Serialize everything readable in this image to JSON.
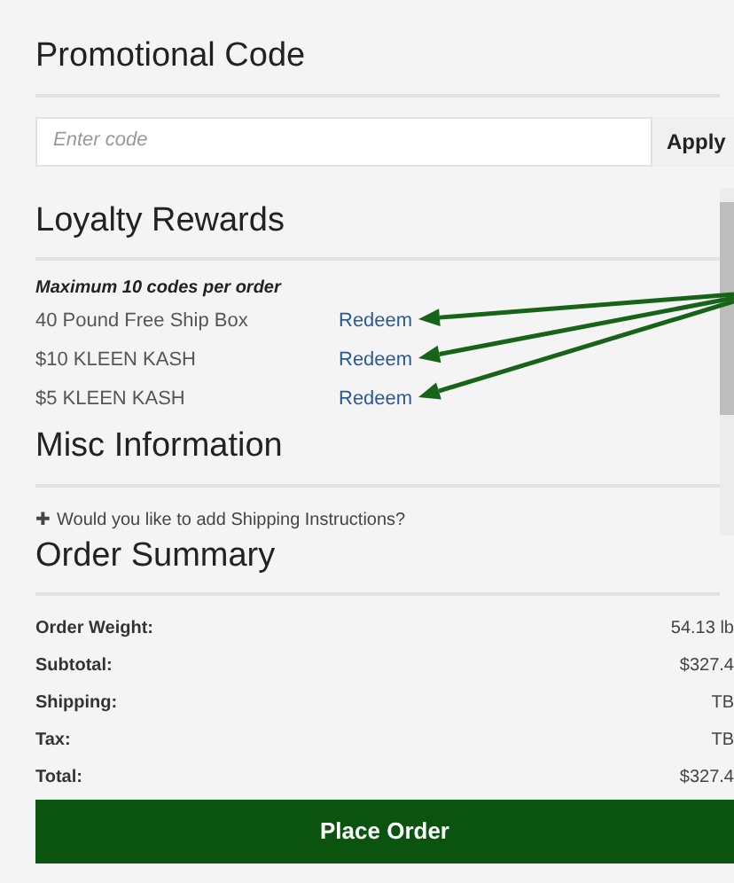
{
  "promo": {
    "title": "Promotional Code",
    "placeholder": "Enter code",
    "button": "Apply"
  },
  "loyalty": {
    "title": "Loyalty Rewards",
    "note": "Maximum 10 codes per order",
    "rewards": [
      {
        "name": "40 Pound Free Ship Box",
        "action": "Redeem",
        "arrow": true
      },
      {
        "name": "$10 KLEEN KASH",
        "action": "Redeem",
        "arrow": true
      },
      {
        "name": "$5 KLEEN KASH",
        "action": "Redeem",
        "arrow": true
      }
    ]
  },
  "misc": {
    "title": "Misc Information",
    "icon": "✚",
    "link": "Would you like to add Shipping Instructions?"
  },
  "summary": {
    "title": "Order Summary",
    "rows": [
      {
        "label": "Order Weight:",
        "value": "54.13 lb"
      },
      {
        "label": "Subtotal:",
        "value": "$327.4"
      },
      {
        "label": "Shipping:",
        "value": "TB"
      },
      {
        "label": "Tax:",
        "value": "TB"
      },
      {
        "label": "Total:",
        "value": "$327.4"
      }
    ],
    "button": "Place Order"
  }
}
